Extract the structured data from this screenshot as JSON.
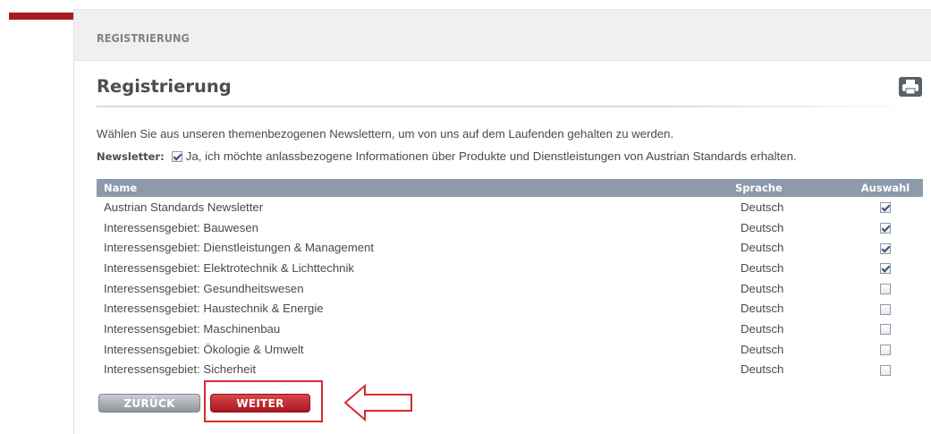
{
  "breadcrumb": {
    "label": "REGISTRIERUNG"
  },
  "page": {
    "title": "Registrierung"
  },
  "intro_text": "Wählen Sie aus unseren themenbezogenen Newslettern, um von uns auf dem Laufenden gehalten zu werden.",
  "newsletter_optin": {
    "label": "Newsletter:",
    "text": "Ja, ich möchte anlassbezogene Informationen über Produkte und Dienstleistungen von Austrian Standards erhalten.",
    "checked": true
  },
  "table": {
    "headers": {
      "name": "Name",
      "language": "Sprache",
      "selection": "Auswahl"
    },
    "rows": [
      {
        "name": "Austrian Standards Newsletter",
        "language": "Deutsch",
        "selected": true
      },
      {
        "name": "Interessensgebiet: Bauwesen",
        "language": "Deutsch",
        "selected": true
      },
      {
        "name": "Interessensgebiet: Dienstleistungen & Management",
        "language": "Deutsch",
        "selected": true
      },
      {
        "name": "Interessensgebiet: Elektrotechnik & Lichttechnik",
        "language": "Deutsch",
        "selected": true
      },
      {
        "name": "Interessensgebiet: Gesundheitswesen",
        "language": "Deutsch",
        "selected": false
      },
      {
        "name": "Interessensgebiet: Haustechnik & Energie",
        "language": "Deutsch",
        "selected": false
      },
      {
        "name": "Interessensgebiet: Maschinenbau",
        "language": "Deutsch",
        "selected": false
      },
      {
        "name": "Interessensgebiet: Ökologie & Umwelt",
        "language": "Deutsch",
        "selected": false
      },
      {
        "name": "Interessensgebiet: Sicherheit",
        "language": "Deutsch",
        "selected": false
      }
    ]
  },
  "buttons": {
    "back": "ZURÜCK",
    "next": "WEITER"
  },
  "icons": {
    "print": "print-icon",
    "annotation_arrow": "left-arrow-icon"
  },
  "colors": {
    "brand_red": "#a71c22",
    "table_header": "#8c9aab",
    "highlight": "#d42a30"
  }
}
